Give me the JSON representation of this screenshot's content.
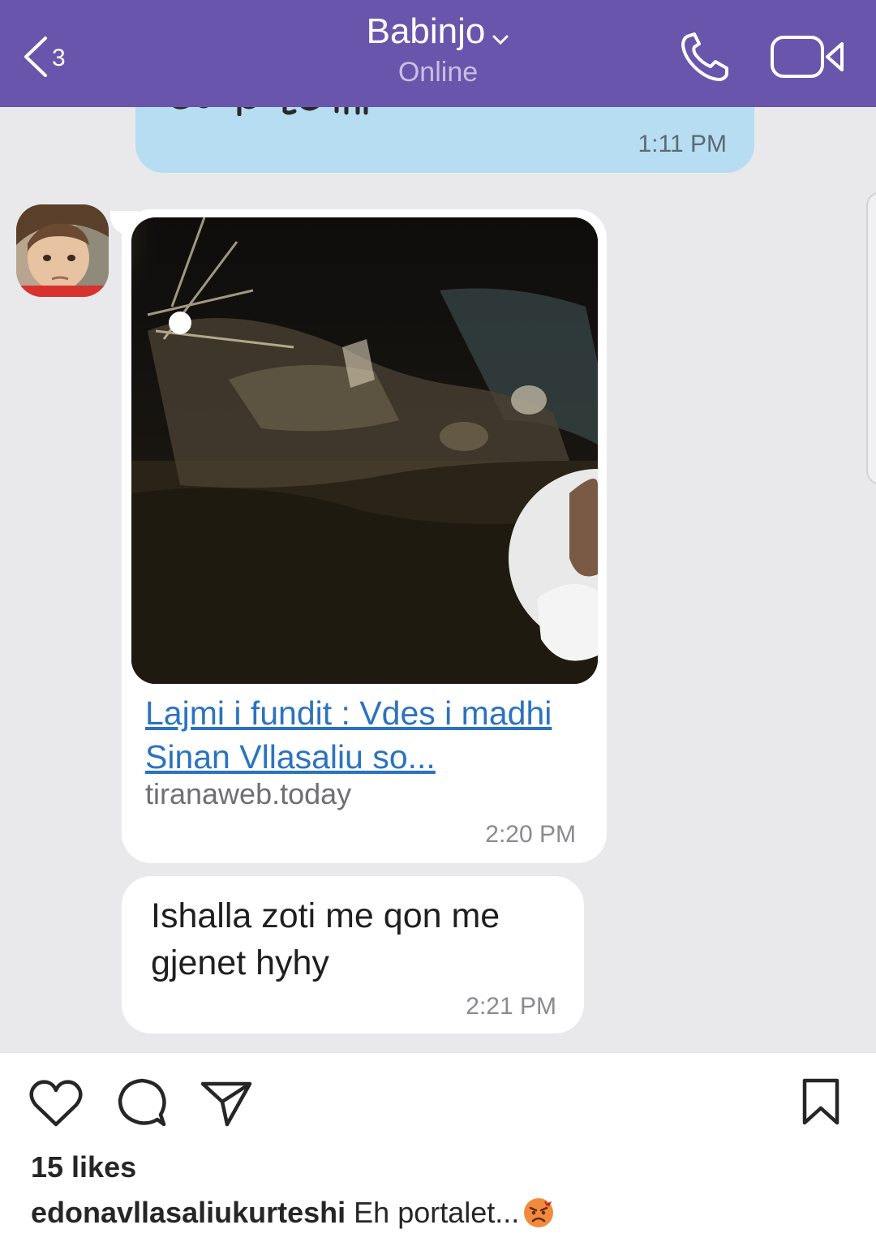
{
  "header": {
    "back_count": "3",
    "contact_name": "Babinjo",
    "status": "Online",
    "icons": [
      "back-chevron-icon",
      "chevron-down-icon",
      "phone-icon",
      "video-camera-icon"
    ],
    "background": "#6a55ac"
  },
  "messages": {
    "outgoing_partial": {
      "text_fragment": "qe po te thi...",
      "time": "1:11 PM"
    },
    "link_preview": {
      "title": "Lajmi i fundit : Vdes i madhi Sinan Vllasaliu so...",
      "domain": "tiranaweb.today",
      "time": "2:20 PM"
    },
    "text_message": {
      "text": "Ishalla zoti me qon me gjenet hyhy",
      "time": "2:21 PM"
    }
  },
  "instagram": {
    "icons": [
      "heart-icon",
      "comment-icon",
      "share-icon",
      "bookmark-icon"
    ],
    "likes": "15 likes",
    "caption_user": "edonavllasaliukurteshi",
    "caption_text": "Eh portalet..."
  },
  "colors": {
    "chat_background": "#e9e9ec",
    "outgoing_bubble": "#b6ddf2",
    "link": "#2b73c0"
  }
}
